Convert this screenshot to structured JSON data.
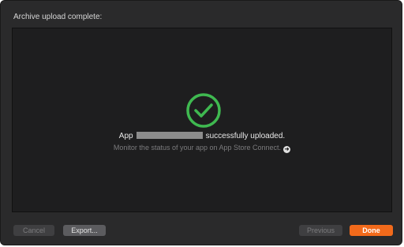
{
  "dialog": {
    "title": "Archive upload complete:"
  },
  "status": {
    "message_prefix": "App",
    "message_suffix": "successfully uploaded.",
    "hint": "Monitor the status of your app on App Store Connect.",
    "icon": "checkmark-circle-icon",
    "link_icon": "arrow-circle-right-icon",
    "success_color": "#3fb950"
  },
  "buttons": {
    "cancel": "Cancel",
    "export": "Export...",
    "previous": "Previous",
    "done": "Done",
    "accent_color": "#f26a1b"
  }
}
